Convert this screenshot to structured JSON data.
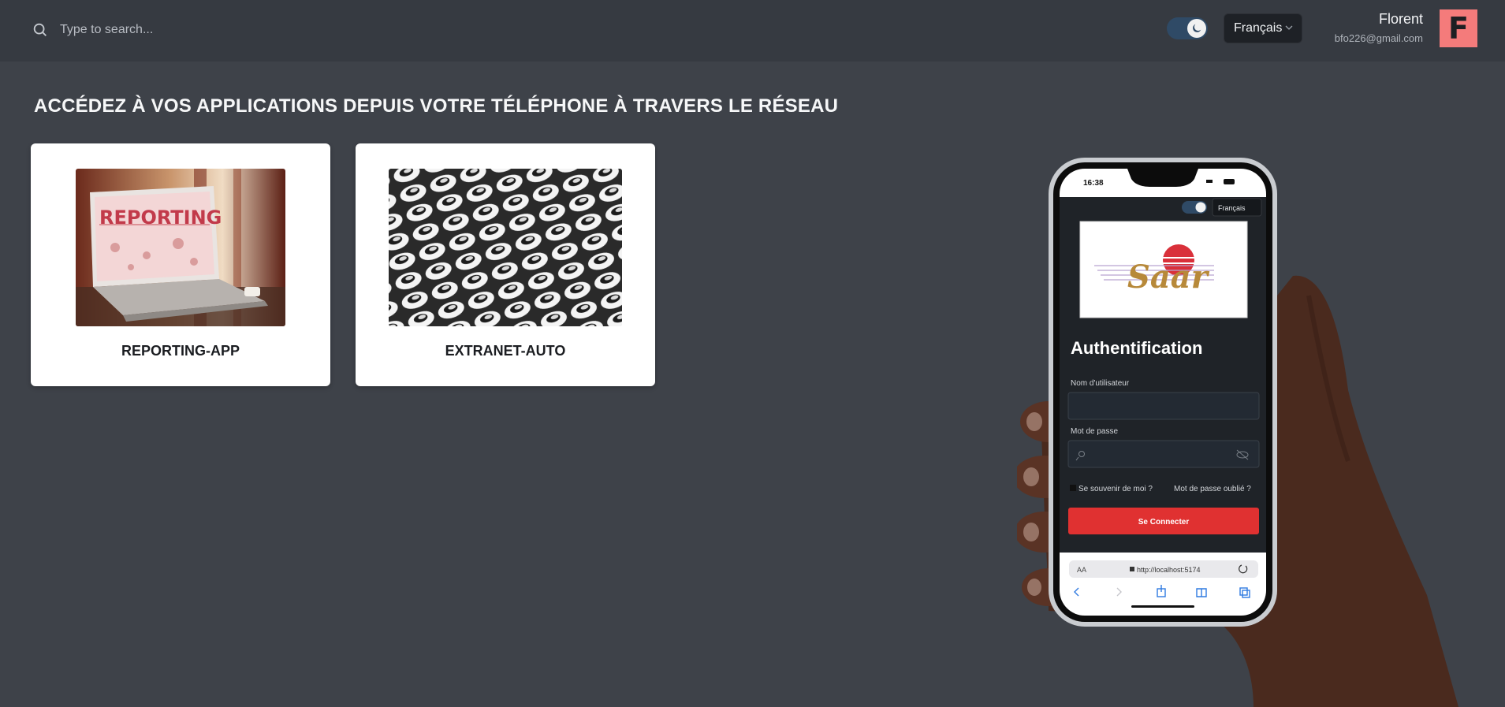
{
  "topbar": {
    "search_placeholder": "Type to search...",
    "theme_toggle": "dark",
    "language": "Français",
    "user_name": "Florent",
    "user_email": "bfo226@gmail.com",
    "avatar_initial": "F",
    "avatar_color": "#f47b7b"
  },
  "main": {
    "heading": "ACCÉDEZ À VOS APPLICATIONS DEPUIS VOTRE TÉLÉPHONE À TRAVERS LE RÉSEAU",
    "apps": [
      {
        "label": "REPORTING-APP",
        "image": "laptop-reporting-photo",
        "image_text": "REPORTING"
      },
      {
        "label": "EXTRANET-AUTO",
        "image": "rows-of-cars-photo"
      }
    ]
  },
  "phone": {
    "time": "16:38",
    "language": "Français",
    "logo_text": "Saar",
    "title": "Authentification",
    "username_label": "Nom d'utilisateur",
    "password_label": "Mot de passe",
    "remember_label": "Se souvenir de moi ?",
    "forgot_label": "Mot de passe oublié ?",
    "submit_label": "Se Connecter",
    "url_prefix": "AA",
    "url": "http://localhost:5174",
    "accent_color": "#e03131"
  }
}
